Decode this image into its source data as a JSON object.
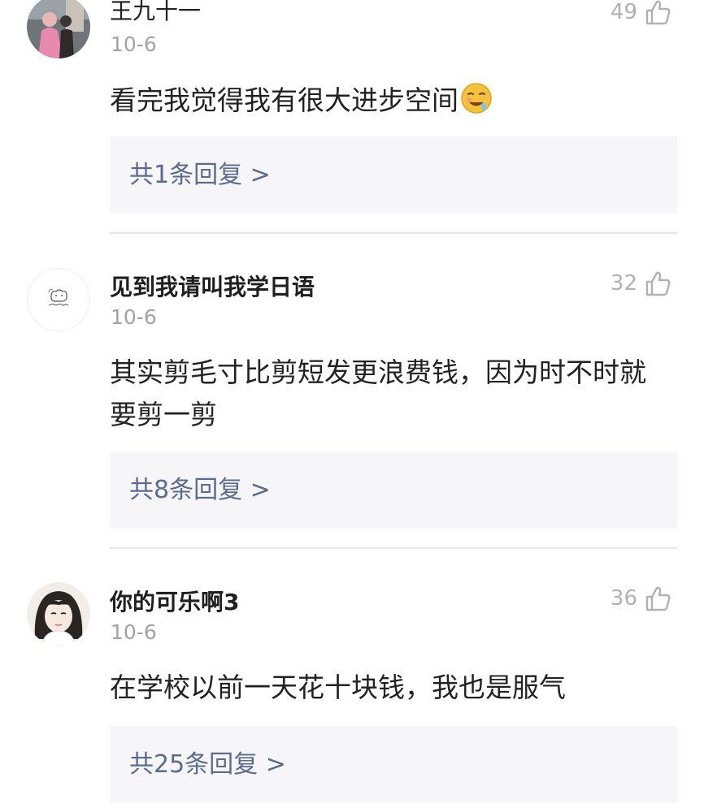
{
  "comments": [
    {
      "username": "王九十一",
      "date": "10-6",
      "likes": "49",
      "content": "看完我觉得我有很大进步空间",
      "emoji": "drooling-face-emoji",
      "reply_link": "共1条回复 >",
      "avatar": "photo-avatar"
    },
    {
      "username": "见到我请叫我学日语",
      "date": "10-6",
      "likes": "32",
      "content": "其实剪毛寸比剪短发更浪费钱，因为时不时就要剪一剪",
      "reply_link": "共8条回复 >",
      "avatar": "sketch-cat-avatar"
    },
    {
      "username": "你的可乐啊3",
      "date": "10-6",
      "likes": "36",
      "content": "在学校以前一天花十块钱，我也是服气",
      "reply_link": "共25条回复 >",
      "avatar": "cartoon-girl-avatar"
    }
  ],
  "icons": {
    "like": "thumbs-up-icon"
  },
  "colors": {
    "reply_link": "#5b6b8f",
    "reply_bg": "#f6f6f8",
    "meta_text": "#a2a2a2"
  }
}
